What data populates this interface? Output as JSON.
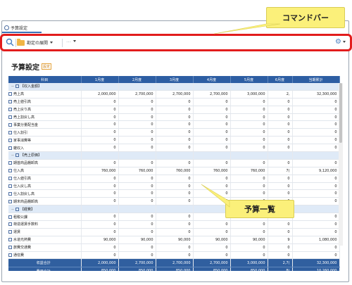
{
  "tab": {
    "label": "予算設定"
  },
  "toolbar": {
    "dropdown_label": "勘定の展開",
    "more_label": "…"
  },
  "callouts": {
    "command_bar": "コマンドバー",
    "budget_list": "予算一覧"
  },
  "page": {
    "title": "予算設定",
    "badge": "設定"
  },
  "table": {
    "columns": [
      "科目",
      "1月度",
      "2月度",
      "3月度",
      "4月度",
      "5月度",
      "6月度",
      "当期累計"
    ],
    "rows": [
      {
        "type": "group",
        "name": "【収入金額】",
        "values": [
          "",
          "",
          "",
          "",
          "",
          "",
          ""
        ]
      },
      {
        "type": "item",
        "name": "売上高",
        "values": [
          "2,000,000",
          "2,700,000",
          "2,700,000",
          "2,700,000",
          "3,000,000",
          "2,",
          "32,300,000"
        ]
      },
      {
        "type": "item",
        "name": "売上値引高",
        "values": [
          "0",
          "0",
          "0",
          "0",
          "0",
          "0",
          "0"
        ]
      },
      {
        "type": "item",
        "name": "売上戻り高",
        "values": [
          "0",
          "0",
          "0",
          "0",
          "0",
          "0",
          "0"
        ]
      },
      {
        "type": "item",
        "name": "売上割戻し高",
        "values": [
          "0",
          "0",
          "0",
          "0",
          "0",
          "0",
          "0"
        ]
      },
      {
        "type": "item",
        "name": "事業分量配当金",
        "values": [
          "0",
          "0",
          "0",
          "0",
          "0",
          "0",
          "0"
        ]
      },
      {
        "type": "item",
        "name": "仕入割引",
        "values": [
          "0",
          "0",
          "0",
          "0",
          "0",
          "0",
          "0"
        ]
      },
      {
        "type": "item",
        "name": "家事消費等",
        "values": [
          "0",
          "0",
          "0",
          "0",
          "0",
          "0",
          "0"
        ]
      },
      {
        "type": "item",
        "name": "雑収入",
        "values": [
          "0",
          "0",
          "0",
          "0",
          "0",
          "0",
          "0"
        ]
      },
      {
        "type": "group",
        "name": "【売上原価】",
        "values": [
          "",
          "",
          "",
          "",
          "",
          "",
          ""
        ]
      },
      {
        "type": "item",
        "name": "期首商品棚卸高",
        "values": [
          "0",
          "0",
          "0",
          "0",
          "0",
          "0",
          "0"
        ]
      },
      {
        "type": "item",
        "name": "仕入高",
        "values": [
          "760,000",
          "760,000",
          "760,000",
          "760,000",
          "760,000",
          "7(",
          "9,120,000"
        ]
      },
      {
        "type": "item",
        "name": "仕入値引高",
        "values": [
          "0",
          "0",
          "0",
          "0",
          "0",
          "0",
          "0"
        ]
      },
      {
        "type": "item",
        "name": "仕入戻し高",
        "values": [
          "0",
          "0",
          "0",
          "0",
          "0",
          "0",
          "0"
        ]
      },
      {
        "type": "item",
        "name": "仕入割戻し高",
        "values": [
          "0",
          "0",
          "0",
          "0",
          "0",
          "0",
          "0"
        ]
      },
      {
        "type": "item",
        "name": "期末商品棚卸高",
        "values": [
          "0",
          "0",
          "0",
          "0",
          "0",
          "0",
          "0"
        ]
      },
      {
        "type": "group",
        "name": "【経費】",
        "values": [
          "",
          "",
          "",
          "",
          "",
          "",
          ""
        ]
      },
      {
        "type": "item",
        "name": "租税公課",
        "values": [
          "0",
          "0",
          "0",
          "0",
          "0",
          "0",
          "0"
        ]
      },
      {
        "type": "item",
        "name": "荷造運賃手数料",
        "values": [
          "0",
          "0",
          "0",
          "0",
          "0",
          "0",
          "0"
        ]
      },
      {
        "type": "item",
        "name": "運賃",
        "values": [
          "0",
          "0",
          "0",
          "0",
          "0",
          "0",
          "0"
        ]
      },
      {
        "type": "item",
        "name": "水道光熱費",
        "values": [
          "90,000",
          "90,000",
          "90,000",
          "90,000",
          "90,000",
          "9",
          "1,080,000"
        ]
      },
      {
        "type": "item",
        "name": "旅費交通費",
        "values": [
          "0",
          "0",
          "0",
          "0",
          "0",
          "0",
          "0"
        ]
      },
      {
        "type": "item",
        "name": "通信費",
        "values": [
          "0",
          "0",
          "0",
          "0",
          "0",
          "0",
          "0"
        ]
      }
    ],
    "totals": [
      {
        "name": "収益合計",
        "values": [
          "2,000,000",
          "2,700,000",
          "2,700,000",
          "2,700,000",
          "3,000,000",
          "2,7(",
          "32,300,000"
        ]
      },
      {
        "name": "費用合計",
        "values": [
          "850,000",
          "850,000",
          "850,000",
          "850,000",
          "850,000",
          "8(",
          "10,260,000"
        ]
      },
      {
        "name": "差引損益",
        "values": [
          "1,150,000",
          "1,850,000",
          "1,850,000",
          "1,850,000",
          "2,150,000",
          "1,8(",
          "22,040,000"
        ]
      }
    ]
  },
  "colors": {
    "header": "#2d5ea3",
    "group_row": "#dfeaf7",
    "total_row": "#305f9f",
    "command_bar_border": "#e21c1c",
    "callout": "#fbf07a"
  }
}
